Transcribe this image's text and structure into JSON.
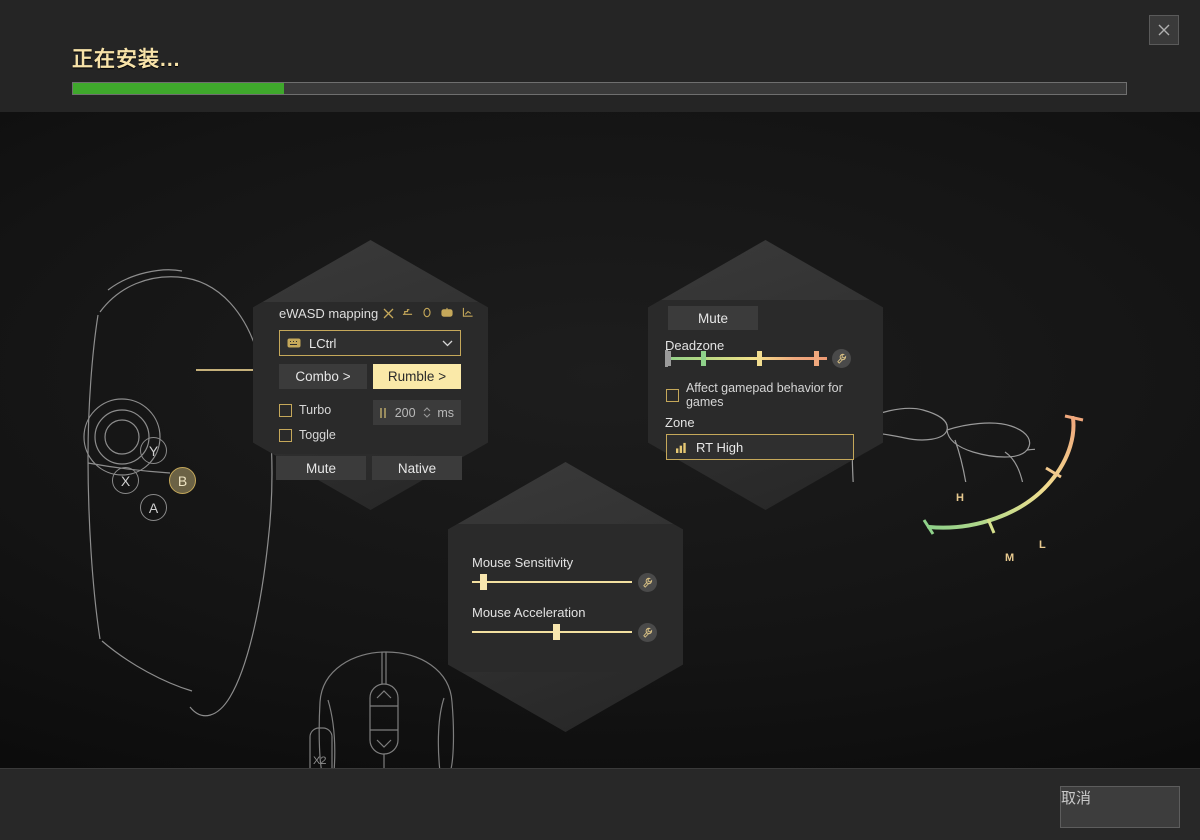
{
  "window": {
    "title": "正在安装...",
    "close_icon": "close-icon",
    "cancel_label": "取消"
  },
  "progress": {
    "percent": 20,
    "fill_color": "#3fa82c",
    "track_color": "#3a3a3a"
  },
  "mapping_panel": {
    "title": "eWASD mapping",
    "close_icon": "close-icon",
    "header_icons": [
      "gamepad-icon",
      "clock-icon",
      "mouse-icon",
      "chart-icon"
    ],
    "binding": {
      "icon": "keyboard-icon",
      "value": "LCtrl",
      "chevron": "chevron-down-icon"
    },
    "combo_label": "Combo >",
    "rumble_label": "Rumble >",
    "turbo_label": "Turbo",
    "turbo_checked": false,
    "toggle_label": "Toggle",
    "toggle_checked": false,
    "interval": {
      "icon": "pause-icon",
      "value": "200",
      "unit": "ms",
      "spinner": "spinner-icon"
    },
    "mute_label": "Mute",
    "native_label": "Native"
  },
  "trigger_panel": {
    "mute_label": "Mute",
    "deadzone_label": "Deadzone",
    "deadzone_stops": [
      0,
      22,
      57,
      92
    ],
    "deadzone_wrench": "wrench-icon",
    "affect_label": "Affect gamepad behavior for games",
    "affect_checked": false,
    "zone_label": "Zone",
    "zone": {
      "icon": "bars-icon",
      "value": "RT High"
    }
  },
  "mouse_panel": {
    "sensitivity_label": "Mouse Sensitivity",
    "sensitivity_value": 5,
    "sensitivity_wrench": "wrench-icon",
    "acceleration_label": "Mouse Acceleration",
    "acceleration_value": 53,
    "acceleration_wrench": "wrench-icon"
  },
  "controller_art": {
    "buttons": [
      "Y",
      "X",
      "B",
      "A"
    ],
    "highlighted": "B"
  },
  "mouse_art": {
    "side_button_label": "X2"
  },
  "trigger_arc": {
    "labels": [
      "L",
      "M",
      "H"
    ],
    "gradient": [
      "#8fd18a",
      "#f2dd90",
      "#f0a87d"
    ]
  },
  "colors": {
    "accent_gold": "#f7e2a8",
    "border_gold": "#c5a85a",
    "green": "#3fa82c",
    "panel": "#343434"
  }
}
